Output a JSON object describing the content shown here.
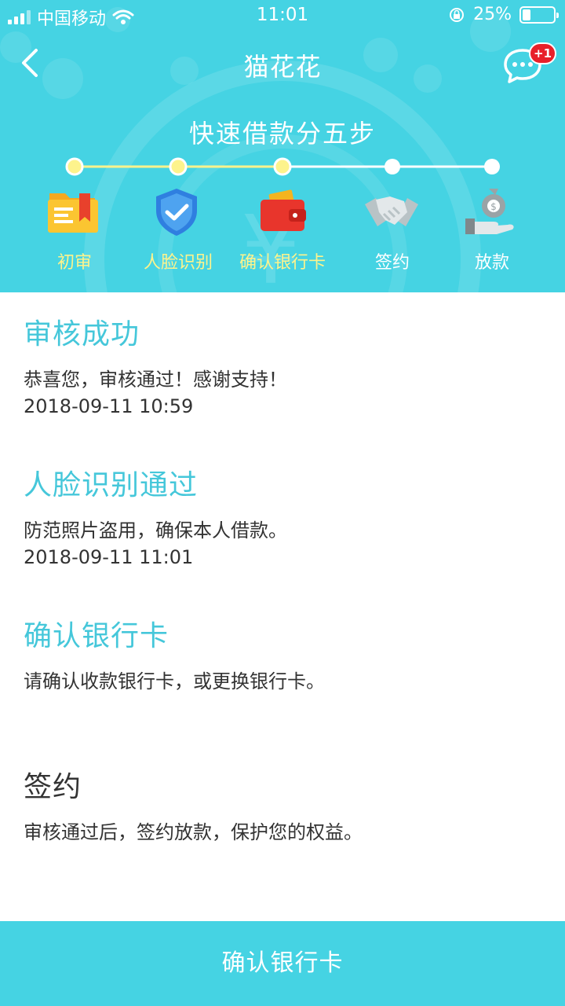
{
  "status_bar": {
    "carrier": "中国移动",
    "time": "11:01",
    "battery": "25%",
    "battery_level": 0.25
  },
  "navbar": {
    "title": "猫花花",
    "message_badge": "+1"
  },
  "steps": {
    "title": "快速借款分五步",
    "items": [
      {
        "label": "初审",
        "done": true,
        "icon": "folder-bookmark-icon"
      },
      {
        "label": "人脸识别",
        "done": true,
        "icon": "shield-check-icon"
      },
      {
        "label": "确认银行卡",
        "done": true,
        "icon": "wallet-icon"
      },
      {
        "label": "签约",
        "done": false,
        "icon": "handshake-icon"
      },
      {
        "label": "放款",
        "done": false,
        "icon": "money-bag-hand-icon"
      }
    ]
  },
  "sections": [
    {
      "title": "审核成功",
      "desc": "恭喜您，审核通过！感谢支持！",
      "time": "2018-09-11 10:59",
      "done": true
    },
    {
      "title": "人脸识别通过",
      "desc": "防范照片盗用，确保本人借款。",
      "time": "2018-09-11 11:01",
      "done": true
    },
    {
      "title": "确认银行卡",
      "desc": "请确认收款银行卡，或更换银行卡。",
      "time": "",
      "done": true
    },
    {
      "title": "签约",
      "desc": "审核通过后，签约放款，保护您的权益。",
      "time": "",
      "done": false
    }
  ],
  "bottom_button": {
    "label": "确认银行卡"
  },
  "colors": {
    "primary": "#45d3e3",
    "accent_text": "#45c7da",
    "step_done_label": "#fdf38c",
    "badge": "#e8202a"
  }
}
